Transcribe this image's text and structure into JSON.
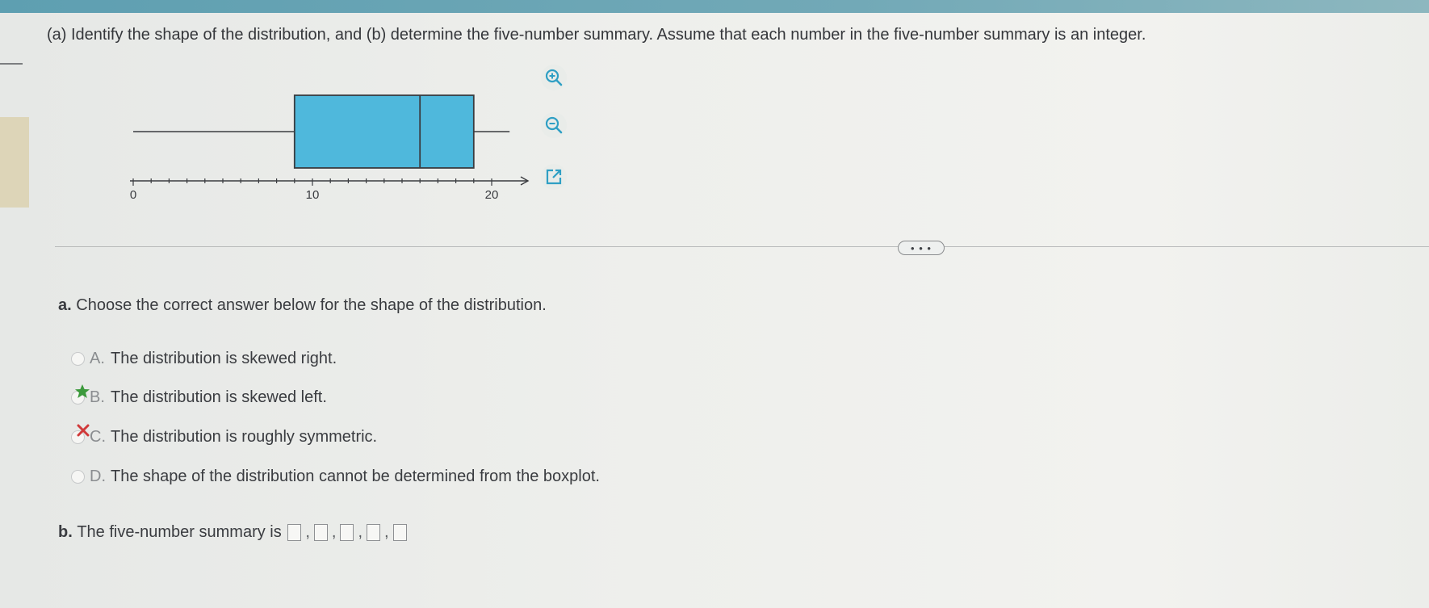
{
  "question": {
    "text": "(a) Identify the shape of the distribution, and (b) determine the five-number summary. Assume that each number in the five-number summary is an integer."
  },
  "boxplot": {
    "axis": {
      "min": 0,
      "max": 20,
      "ticks": [
        "0",
        "10",
        "20"
      ],
      "tick_step": 1
    },
    "whisker_min": 0,
    "q1": 9,
    "median": 16,
    "q3": 19,
    "whisker_max": 21,
    "box_color": "#4fb8dc",
    "line_color": "#3a3c40"
  },
  "tools": [
    "zoom-in-icon",
    "zoom-out-icon",
    "popout-icon"
  ],
  "more_pill": {
    "label": "• • •"
  },
  "part_a": {
    "label": "a.",
    "prompt": "Choose the correct answer below for the shape of the distribution.",
    "options": [
      {
        "letter": "A.",
        "text": "The distribution is skewed right.",
        "marker": "none"
      },
      {
        "letter": "B.",
        "text": "The distribution is skewed left.",
        "marker": "correct-star"
      },
      {
        "letter": "C.",
        "text": "The distribution is roughly symmetric.",
        "marker": "incorrect-x"
      },
      {
        "letter": "D.",
        "text": "The shape of the distribution cannot be determined from the boxplot.",
        "marker": "none"
      }
    ]
  },
  "part_b": {
    "label": "b.",
    "prompt": "The five-number summary is",
    "boxes": [
      "",
      "",
      "",
      "",
      ""
    ]
  },
  "colors": {
    "accent_bar": "#5e9fb1",
    "correct": "#3c9a3c",
    "incorrect": "#d03a3a"
  }
}
